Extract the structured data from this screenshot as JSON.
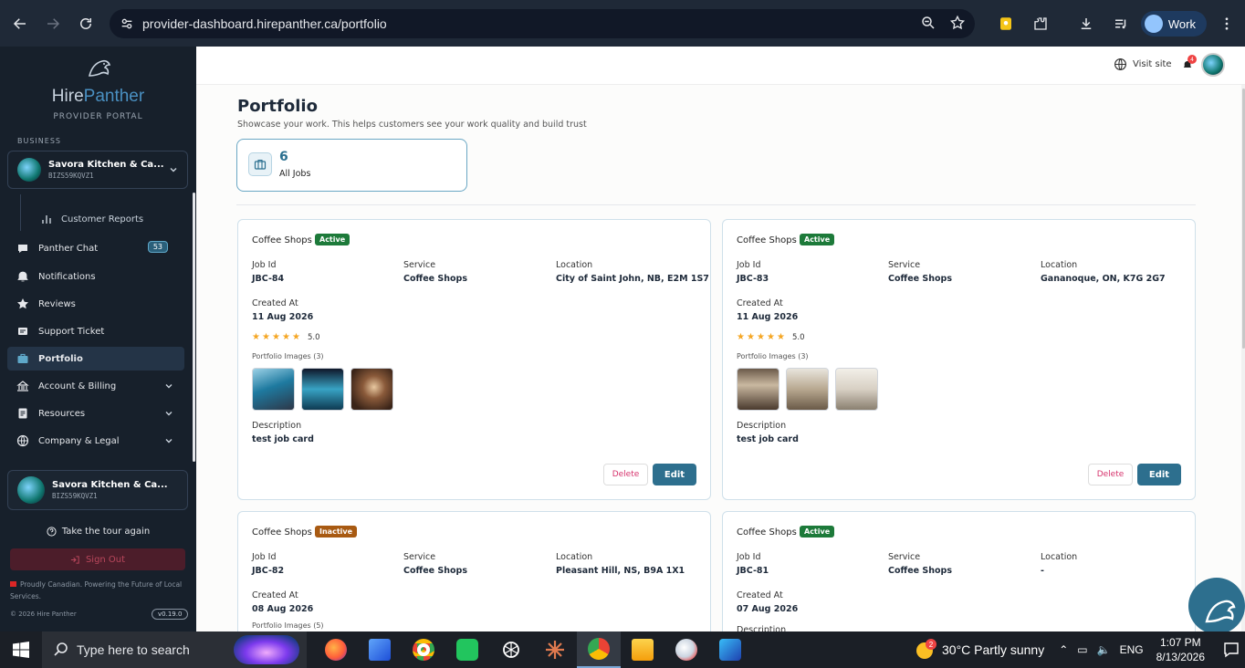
{
  "browser": {
    "url": "provider-dashboard.hirepanther.ca/portfolio",
    "profile_label": "Work"
  },
  "sidebar": {
    "logo_prefix": "Hire",
    "logo_accent": "Panther",
    "logo_sub": "PROVIDER PORTAL",
    "section_label": "BUSINESS",
    "business_name": "Savora Kitchen & Ca...",
    "business_id": "BIZS59KQVZ1",
    "sub_item": "Customer Reports",
    "items": [
      {
        "label": "Panther Chat",
        "badge": "53"
      },
      {
        "label": "Notifications"
      },
      {
        "label": "Reviews"
      },
      {
        "label": "Support Ticket"
      },
      {
        "label": "Portfolio"
      },
      {
        "label": "Account & Billing"
      },
      {
        "label": "Resources"
      },
      {
        "label": "Company & Legal"
      }
    ],
    "bottom_business_name": "Savora Kitchen & Ca...",
    "bottom_business_id": "BIZS59KQVZ1",
    "tour_label": "Take the tour again",
    "signout_label": "Sign Out",
    "proud_text": "Proudly Canadian. Powering the Future of Local Services.",
    "copyright": "© 2026 Hire Panther",
    "version": "v0.19.0"
  },
  "topbar": {
    "visit_site": "Visit site",
    "notif_count": "4"
  },
  "page": {
    "title": "Portfolio",
    "subtitle": "Showcase your work. This helps customers see your work quality and build trust",
    "stat_value": "6",
    "stat_label": "All Jobs"
  },
  "labels": {
    "job_id": "Job Id",
    "service": "Service",
    "location": "Location",
    "created_at": "Created At",
    "description": "Description",
    "delete": "Delete",
    "edit": "Edit"
  },
  "jobs": [
    {
      "category": "Coffee Shops",
      "status": "Active",
      "job_id": "JBC-84",
      "service": "Coffee Shops",
      "location": "City of Saint John, NB, E2M 1S7",
      "created_at": "11 Aug 2026",
      "rating": "5.0",
      "images_label": "Portfolio Images (3)",
      "description": "test job card"
    },
    {
      "category": "Coffee Shops",
      "status": "Active",
      "job_id": "JBC-83",
      "service": "Coffee Shops",
      "location": "Gananoque, ON, K7G 2G7",
      "created_at": "11 Aug 2026",
      "rating": "5.0",
      "images_label": "Portfolio Images (3)",
      "description": "test job card"
    },
    {
      "category": "Coffee Shops",
      "status": "Inactive",
      "job_id": "JBC-82",
      "service": "Coffee Shops",
      "location": "Pleasant Hill, NS, B9A 1X1",
      "created_at": "08 Aug 2026",
      "images_label": "Portfolio Images (5)"
    },
    {
      "category": "Coffee Shops",
      "status": "Active",
      "job_id": "JBC-81",
      "service": "Coffee Shops",
      "location": "-",
      "created_at": "07 Aug 2026",
      "description_label": "Description"
    }
  ],
  "taskbar": {
    "search_placeholder": "Type here to search",
    "weather": "30°C  Partly sunny",
    "weather_badge": "2",
    "lang": "ENG",
    "time": "1:07 PM",
    "date": "8/13/2026"
  },
  "colors": {
    "sidebar_bg": "#17202b",
    "accent": "#2d6f8e",
    "active_badge": "#1d7a3a",
    "inactive_badge": "#a85a12"
  }
}
